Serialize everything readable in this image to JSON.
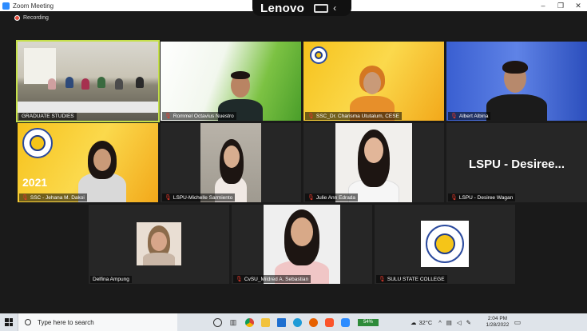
{
  "window": {
    "title": "Zoom Meeting",
    "minimize": "–",
    "maximize": "❐",
    "close": "✕"
  },
  "overlay": {
    "brand": "Lenovo",
    "chevron": "‹"
  },
  "recording": {
    "label": "Recording"
  },
  "participants": [
    {
      "name": "GRADUATE STUDIES",
      "muted": false,
      "active": true
    },
    {
      "name": "Rommel Octavius Nuestro",
      "muted": true
    },
    {
      "name": "SSC_Dr. Charisma Ututalum, CESE",
      "muted": true
    },
    {
      "name": "Albert Albina",
      "muted": true
    },
    {
      "name": "SSC - Jehana M. Dakoi",
      "muted": true
    },
    {
      "name": "LSPU-Michelle Sarmiento",
      "muted": true
    },
    {
      "name": "Julie Ann Edrada",
      "muted": true
    },
    {
      "name": "LSPU - Desiree Wagan",
      "muted": true,
      "display_text": "LSPU - Desiree..."
    },
    {
      "name": "Delfina Ampung",
      "muted": false
    },
    {
      "name": "CvSU_Mildred A. Sebastian",
      "muted": true
    },
    {
      "name": "SULU STATE COLLEGE",
      "muted": true
    }
  ],
  "tile_texts": {
    "year": "2021"
  },
  "taskbar": {
    "search_placeholder": "Type here to search",
    "battery": "54%",
    "temperature": "32°C",
    "time": "2:04 PM",
    "date": "1/28/2022"
  },
  "colors": {
    "active_border": "#c5e04a",
    "muted_icon": "#e0392b",
    "zoom_blue": "#2d8cff"
  }
}
